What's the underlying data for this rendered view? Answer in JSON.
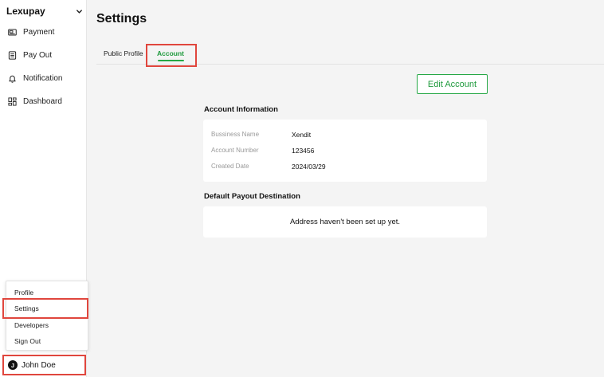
{
  "sidebar": {
    "brand": "Lexupay",
    "items": [
      {
        "label": "Payment",
        "icon": "payment-icon"
      },
      {
        "label": "Pay Out",
        "icon": "payout-list-icon"
      },
      {
        "label": "Notification",
        "icon": "bell-icon"
      },
      {
        "label": "Dashboard",
        "icon": "dashboard-grid-icon"
      }
    ]
  },
  "user_menu": {
    "items": [
      "Profile",
      "Settings",
      "Developers",
      "Sign Out"
    ]
  },
  "user": {
    "initial": "J",
    "name": "John Doe"
  },
  "page": {
    "title": "Settings",
    "tabs": [
      {
        "label": "Public Profile",
        "active": false
      },
      {
        "label": "Account",
        "active": true
      }
    ],
    "edit_button": "Edit Account"
  },
  "account_info": {
    "heading": "Account Information",
    "rows": [
      {
        "label": "Bussiness Name",
        "value": "Xendit"
      },
      {
        "label": "Account Number",
        "value": "123456"
      },
      {
        "label": "Created Date",
        "value": "2024/03/29"
      }
    ]
  },
  "payout": {
    "heading": "Default Payout Destination",
    "empty_text": "Address haven't been set up yet."
  },
  "colors": {
    "accent": "#27a846",
    "highlight": "#e0463d"
  }
}
